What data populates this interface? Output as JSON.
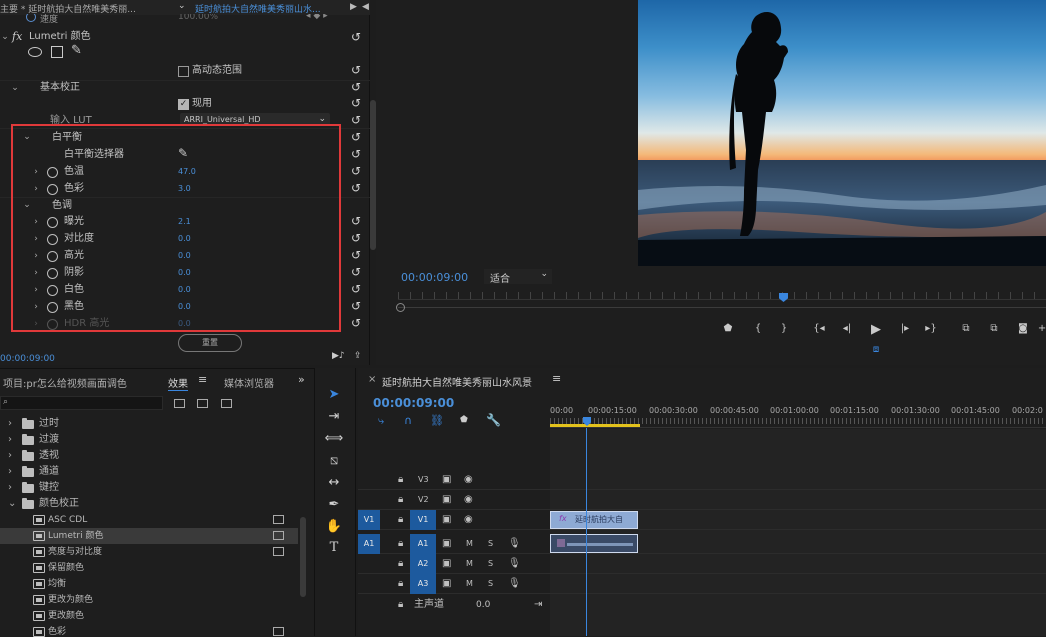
{
  "effect_controls": {
    "tab_master": "主要 * 延时航拍大自然唯美秀丽...",
    "tab_clip": "延时航拍大自然唯美秀丽山水...",
    "speed_label": "速度",
    "speed_value": "100.00%",
    "fx_name": "Lumetri 颜色",
    "hdr_label": "高动态范围",
    "basic_correction": "基本校正",
    "use_label": "现用",
    "input_lut_label": "输入 LUT",
    "input_lut_value": "ARRI_Universal_HD",
    "white_balance": "白平衡",
    "wb_picker": "白平衡选择器",
    "temperature_label": "色温",
    "temperature_value": "47.0",
    "tint_label": "色彩",
    "tint_value": "3.0",
    "tone": "色调",
    "exposure_label": "曝光",
    "exposure_value": "2.1",
    "contrast_label": "对比度",
    "contrast_value": "0.0",
    "highlights_label": "高光",
    "highlights_value": "0.0",
    "shadows_label": "阴影",
    "shadows_value": "0.0",
    "whites_label": "白色",
    "whites_value": "0.0",
    "blacks_label": "黑色",
    "blacks_value": "0.0",
    "hdr_highlights_label": "HDR 高光",
    "hdr_highlights_value": "0.0",
    "reset_button": "重置",
    "timecode": "00:00:09:00"
  },
  "program": {
    "timecode": "00:00:09:00",
    "fit_value": "适合"
  },
  "project_panel": {
    "tab_project": "项目:pr怎么给视频画面调色",
    "tab_effects": "效果",
    "tab_media": "媒体浏览器",
    "items": [
      {
        "label": "过时",
        "type": "folder"
      },
      {
        "label": "过渡",
        "type": "folder"
      },
      {
        "label": "透视",
        "type": "folder"
      },
      {
        "label": "通道",
        "type": "folder"
      },
      {
        "label": "键控",
        "type": "folder"
      },
      {
        "label": "颜色校正",
        "type": "folder-open"
      },
      {
        "label": "ASC CDL",
        "type": "effect"
      },
      {
        "label": "Lumetri 颜色",
        "type": "effect",
        "selected": true
      },
      {
        "label": "亮度与对比度",
        "type": "effect"
      },
      {
        "label": "保留颜色",
        "type": "effect"
      },
      {
        "label": "均衡",
        "type": "effect"
      },
      {
        "label": "更改为颜色",
        "type": "effect"
      },
      {
        "label": "更改颜色",
        "type": "effect"
      },
      {
        "label": "色彩",
        "type": "effect"
      }
    ]
  },
  "timeline": {
    "sequence_name": "延时航拍大自然唯美秀丽山水风景",
    "timecode": "00:00:09:00",
    "ruler": [
      "00:00",
      "00:00:15:00",
      "00:00:30:00",
      "00:00:45:00",
      "00:01:00:00",
      "00:01:15:00",
      "00:01:30:00",
      "00:01:45:00",
      "00:02:0"
    ],
    "tracks": {
      "v3": "V3",
      "v2": "V2",
      "v1": "V1",
      "v1_target": "V1",
      "a1": "A1",
      "a1_target": "A1",
      "a2": "A2",
      "a3": "A3",
      "mute": "M",
      "solo": "S"
    },
    "master_label": "主声道",
    "master_value": "0.0",
    "clip_label": "延时航拍大自",
    "clip_fx": "fx"
  },
  "colors": {
    "accent": "#4a8fd8",
    "highlight_box": "#e0393a",
    "panel_bg": "#1d1d1d"
  }
}
